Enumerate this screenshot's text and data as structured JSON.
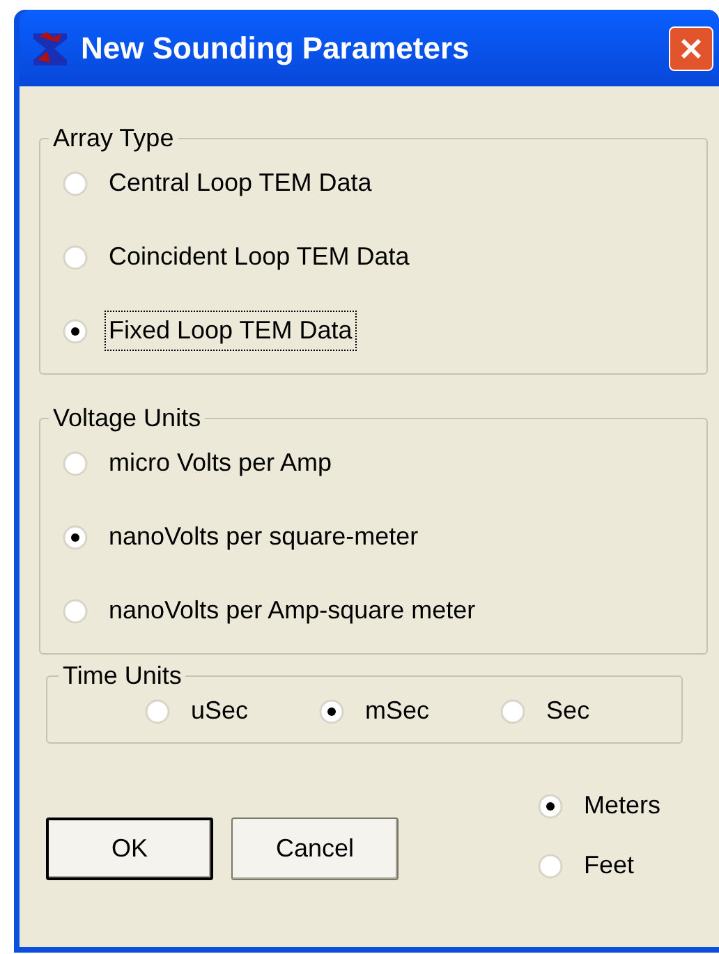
{
  "window": {
    "title": "New Sounding Parameters"
  },
  "array_type": {
    "label": "Array Type",
    "options": [
      {
        "label": "Central Loop TEM Data",
        "selected": false,
        "focused": false
      },
      {
        "label": "Coincident Loop TEM Data",
        "selected": false,
        "focused": false
      },
      {
        "label": "Fixed Loop TEM Data",
        "selected": true,
        "focused": true
      }
    ]
  },
  "voltage_units": {
    "label": "Voltage Units",
    "options": [
      {
        "label": "micro Volts per Amp",
        "selected": false
      },
      {
        "label": "nanoVolts per square-meter",
        "selected": true
      },
      {
        "label": "nanoVolts per Amp-square meter",
        "selected": false
      }
    ]
  },
  "time_units": {
    "label": "Time Units",
    "options": [
      {
        "label": "uSec",
        "selected": false
      },
      {
        "label": "mSec",
        "selected": true
      },
      {
        "label": "Sec",
        "selected": false
      }
    ]
  },
  "distance_units": [
    {
      "label": "Meters",
      "selected": true
    },
    {
      "label": "Feet",
      "selected": false
    }
  ],
  "buttons": [
    "OK",
    "Cancel"
  ]
}
